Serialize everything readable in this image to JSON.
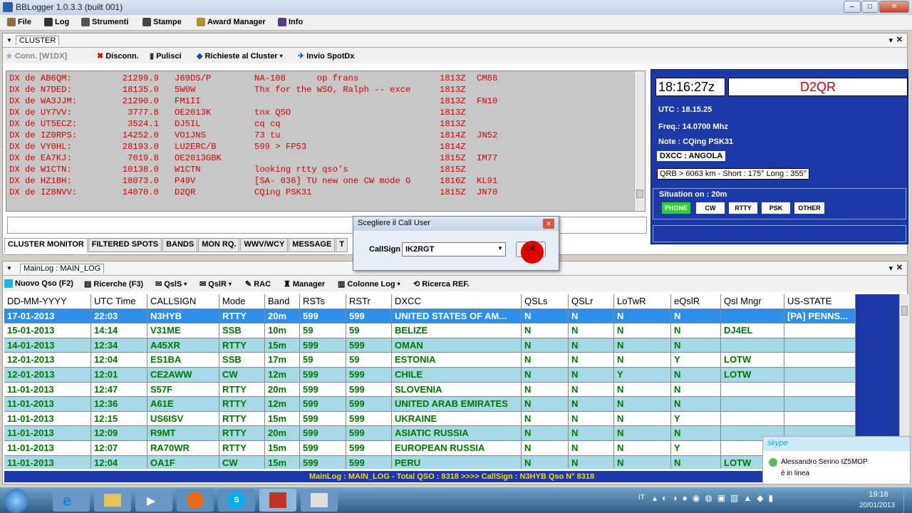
{
  "window": {
    "title": "BBLogger 1.0.3.3 (built 001)"
  },
  "menu": [
    "File",
    "Log",
    "Strumenti",
    "Stampe",
    "Award Manager",
    "Info"
  ],
  "cluster": {
    "tab_label": "CLUSTER",
    "toolbar": {
      "conn": "Conn. [W1DX]",
      "disconn": "Disconn.",
      "clean": "Pulisci",
      "requests": "Richieste al Cluster",
      "send_spot": "Invio SpotDx"
    },
    "lines": [
      [
        "DX de AB6QM:",
        "21299.9",
        "J69DS/P",
        "NA-108      op frans",
        "1813Z",
        "CM88"
      ],
      [
        "DX de N7DED:",
        "18135.0",
        "5W0W",
        "Thx for the WSO, Ralph -- exce",
        "1813Z",
        ""
      ],
      [
        "DX de WA3JJM:",
        "21290.0",
        "FM1II",
        "",
        "1813Z",
        "FN10"
      ],
      [
        "DX de UY7VV:",
        "3777.8",
        "OE2013K",
        "tnx QSO",
        "1813Z",
        ""
      ],
      [
        "DX de UT5ECZ:",
        "3524.1",
        "DJ5IL",
        "cq cq",
        "1813Z",
        ""
      ],
      [
        "DX de IZ0RPS:",
        "14252.0",
        "VO1JNS",
        "73 tu",
        "1814Z",
        "JN52"
      ],
      [
        "DX de VY0HL:",
        "28193.0",
        "LU2ERC/B",
        "599 > FP53",
        "1814Z",
        ""
      ],
      [
        "DX de EA7KJ:",
        "7019.8",
        "OE2013GBK",
        "",
        "1815Z",
        "IM77"
      ],
      [
        "DX de W1CTN:",
        "10138.0",
        "W1CTN",
        "looking rtty qso's",
        "1815Z",
        ""
      ],
      [
        "DX de HZ1BH:",
        "18073.0",
        "P49V",
        "[SA- 036] TU new one CW mode G",
        "1816Z",
        "KL91"
      ],
      [
        "DX de IZ8NVV:",
        "14070.0",
        "D2QR",
        "CQing PSK31",
        "1815Z",
        "JN70"
      ]
    ],
    "tabs": [
      "CLUSTER MONITOR",
      "FILTERED SPOTS",
      "BANDS",
      "MON RQ.",
      "WWV/WCY",
      "MESSAGE",
      "T"
    ]
  },
  "info": {
    "time": "18:16:27z",
    "callsign": "D2QR",
    "utc": "UTC :  18.15.25",
    "freq": "Freq.:  14.0700 Mhz",
    "note": "Note : CQing PSK31",
    "dxcc": "DXCC :  ANGOLA",
    "qrb": "QRB > 6063 km - Short : 175° Long : 355°",
    "situation": "Situation on : 20m",
    "modes": [
      "PHONE",
      "CW",
      "RTTY",
      "PSK",
      "OTHER"
    ]
  },
  "dialog": {
    "title": "Scegliere il Call User",
    "label": "CallSign",
    "value": "IK2RGT",
    "ok": "OK"
  },
  "mainlog": {
    "tab_label": "MainLog : MAIN_LOG",
    "toolbar": [
      "Nuovo Qso (F2)",
      "Ricerche (F3)",
      "QslS",
      "QslR",
      "RAC",
      "Manager",
      "Colonne Log",
      "Ricerca REF."
    ],
    "columns": [
      "DD-MM-YYYY",
      "UTC Time",
      "CALLSIGN",
      "Mode",
      "Band",
      "RSTs",
      "RSTr",
      "DXCC",
      "QSLs",
      "QSLr",
      "LoTwR",
      "eQslR",
      "Qsl Mngr",
      "US-STATE"
    ],
    "rows": [
      [
        "17-01-2013",
        "22:03",
        "N3HYB",
        "RTTY",
        "20m",
        "599",
        "599",
        "UNITED STATES OF AM...",
        "N",
        "N",
        "N",
        "N",
        "",
        "[PA] PENNS..."
      ],
      [
        "15-01-2013",
        "14:14",
        "V31ME",
        "SSB",
        "10m",
        "59",
        "59",
        "BELIZE",
        "N",
        "N",
        "N",
        "N",
        "DJ4EL",
        ""
      ],
      [
        "14-01-2013",
        "12:34",
        "A45XR",
        "RTTY",
        "15m",
        "599",
        "599",
        "OMAN",
        "N",
        "N",
        "N",
        "N",
        "",
        ""
      ],
      [
        "12-01-2013",
        "12:04",
        "ES1BA",
        "SSB",
        "17m",
        "59",
        "59",
        "ESTONIA",
        "N",
        "N",
        "N",
        "Y",
        "LOTW",
        ""
      ],
      [
        "12-01-2013",
        "12:01",
        "CE2AWW",
        "CW",
        "12m",
        "599",
        "599",
        "CHILE",
        "N",
        "N",
        "Y",
        "N",
        "LOTW",
        ""
      ],
      [
        "11-01-2013",
        "12:47",
        "S57F",
        "RTTY",
        "20m",
        "599",
        "599",
        "SLOVENIA",
        "N",
        "N",
        "N",
        "N",
        "",
        ""
      ],
      [
        "11-01-2013",
        "12:36",
        "A61E",
        "RTTY",
        "12m",
        "599",
        "599",
        "UNITED ARAB EMIRATES",
        "N",
        "N",
        "N",
        "N",
        "",
        ""
      ],
      [
        "11-01-2013",
        "12:15",
        "US6ISV",
        "RTTY",
        "15m",
        "599",
        "599",
        "UKRAINE",
        "N",
        "N",
        "N",
        "Y",
        "",
        ""
      ],
      [
        "11-01-2013",
        "12:09",
        "R9MT",
        "RTTY",
        "20m",
        "599",
        "599",
        "ASIATIC RUSSIA",
        "N",
        "N",
        "N",
        "N",
        "",
        ""
      ],
      [
        "11-01-2013",
        "12:07",
        "RA70WR",
        "RTTY",
        "15m",
        "599",
        "599",
        "EUROPEAN RUSSIA",
        "N",
        "N",
        "N",
        "Y",
        "",
        ""
      ],
      [
        "11-01-2013",
        "12:04",
        "OA1F",
        "CW",
        "15m",
        "599",
        "599",
        "PERU",
        "N",
        "N",
        "N",
        "N",
        "LOTW",
        ""
      ]
    ],
    "status": "MainLog : MAIN_LOG  -  Total QSO : 8318    >>>> CallSign : N3HYB    Qso N° 8318"
  },
  "popup": {
    "brand": "skype",
    "name": "Alessandro Serino IZ5MOP",
    "status": "è in linea"
  },
  "tray": {
    "lang": "IT",
    "time": "19:16",
    "date": "20/01/2013"
  }
}
